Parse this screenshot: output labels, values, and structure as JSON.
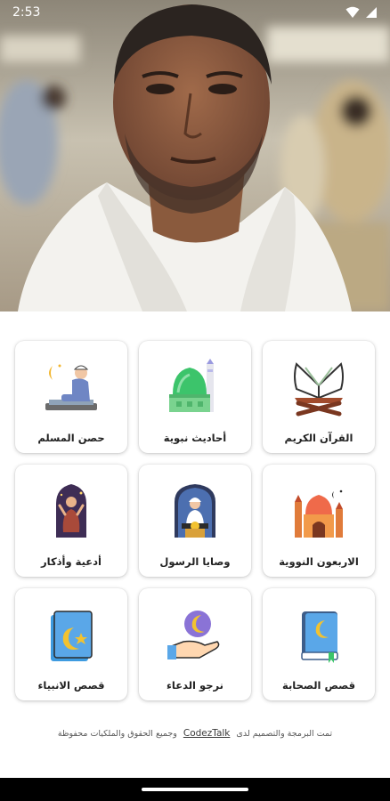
{
  "status_bar": {
    "time": "2:53",
    "icons": [
      "wifi-icon",
      "signal-icon"
    ]
  },
  "hero": {
    "image": "portrait-photo"
  },
  "cards": [
    {
      "label": "حصن المسلم",
      "icon": "praying-man-icon"
    },
    {
      "label": "أحاديث نبوية",
      "icon": "mosque-dome-icon"
    },
    {
      "label": "القرآن الكريم",
      "icon": "quran-book-icon"
    },
    {
      "label": "أدعية وأذكار",
      "icon": "dua-prayer-icon"
    },
    {
      "label": "وصايا الرسول",
      "icon": "imam-minbar-icon"
    },
    {
      "label": "الاربعون النووية",
      "icon": "mosque-building-icon"
    },
    {
      "label": "قصص الانبياء",
      "icon": "moon-card-icon"
    },
    {
      "label": "نرجو الدعاء",
      "icon": "hand-moon-icon"
    },
    {
      "label": "قصص الصحابة",
      "icon": "moon-book-icon"
    }
  ],
  "footer": {
    "text_before": "تمت البرمجة والتصميم لدى",
    "brand": "CodezTalk",
    "text_after": "وجميع الحقوق والملكيات محفوظة"
  },
  "colors": {
    "background": "#ffffff",
    "nav_bar": "#000000",
    "accent_green": "#3cc46b",
    "accent_blue": "#5aa7e8"
  }
}
